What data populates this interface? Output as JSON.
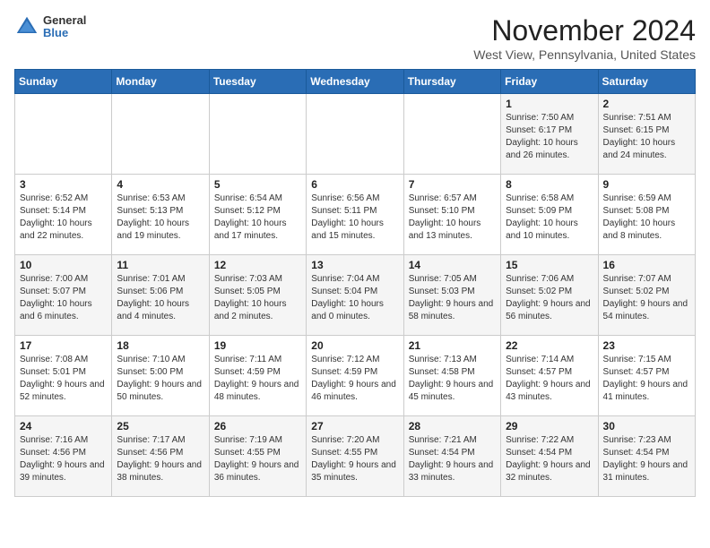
{
  "logo": {
    "general": "General",
    "blue": "Blue"
  },
  "title": "November 2024",
  "location": "West View, Pennsylvania, United States",
  "days_of_week": [
    "Sunday",
    "Monday",
    "Tuesday",
    "Wednesday",
    "Thursday",
    "Friday",
    "Saturday"
  ],
  "weeks": [
    [
      {
        "day": "",
        "info": ""
      },
      {
        "day": "",
        "info": ""
      },
      {
        "day": "",
        "info": ""
      },
      {
        "day": "",
        "info": ""
      },
      {
        "day": "",
        "info": ""
      },
      {
        "day": "1",
        "info": "Sunrise: 7:50 AM\nSunset: 6:17 PM\nDaylight: 10 hours and 26 minutes."
      },
      {
        "day": "2",
        "info": "Sunrise: 7:51 AM\nSunset: 6:15 PM\nDaylight: 10 hours and 24 minutes."
      }
    ],
    [
      {
        "day": "3",
        "info": "Sunrise: 6:52 AM\nSunset: 5:14 PM\nDaylight: 10 hours and 22 minutes."
      },
      {
        "day": "4",
        "info": "Sunrise: 6:53 AM\nSunset: 5:13 PM\nDaylight: 10 hours and 19 minutes."
      },
      {
        "day": "5",
        "info": "Sunrise: 6:54 AM\nSunset: 5:12 PM\nDaylight: 10 hours and 17 minutes."
      },
      {
        "day": "6",
        "info": "Sunrise: 6:56 AM\nSunset: 5:11 PM\nDaylight: 10 hours and 15 minutes."
      },
      {
        "day": "7",
        "info": "Sunrise: 6:57 AM\nSunset: 5:10 PM\nDaylight: 10 hours and 13 minutes."
      },
      {
        "day": "8",
        "info": "Sunrise: 6:58 AM\nSunset: 5:09 PM\nDaylight: 10 hours and 10 minutes."
      },
      {
        "day": "9",
        "info": "Sunrise: 6:59 AM\nSunset: 5:08 PM\nDaylight: 10 hours and 8 minutes."
      }
    ],
    [
      {
        "day": "10",
        "info": "Sunrise: 7:00 AM\nSunset: 5:07 PM\nDaylight: 10 hours and 6 minutes."
      },
      {
        "day": "11",
        "info": "Sunrise: 7:01 AM\nSunset: 5:06 PM\nDaylight: 10 hours and 4 minutes."
      },
      {
        "day": "12",
        "info": "Sunrise: 7:03 AM\nSunset: 5:05 PM\nDaylight: 10 hours and 2 minutes."
      },
      {
        "day": "13",
        "info": "Sunrise: 7:04 AM\nSunset: 5:04 PM\nDaylight: 10 hours and 0 minutes."
      },
      {
        "day": "14",
        "info": "Sunrise: 7:05 AM\nSunset: 5:03 PM\nDaylight: 9 hours and 58 minutes."
      },
      {
        "day": "15",
        "info": "Sunrise: 7:06 AM\nSunset: 5:02 PM\nDaylight: 9 hours and 56 minutes."
      },
      {
        "day": "16",
        "info": "Sunrise: 7:07 AM\nSunset: 5:02 PM\nDaylight: 9 hours and 54 minutes."
      }
    ],
    [
      {
        "day": "17",
        "info": "Sunrise: 7:08 AM\nSunset: 5:01 PM\nDaylight: 9 hours and 52 minutes."
      },
      {
        "day": "18",
        "info": "Sunrise: 7:10 AM\nSunset: 5:00 PM\nDaylight: 9 hours and 50 minutes."
      },
      {
        "day": "19",
        "info": "Sunrise: 7:11 AM\nSunset: 4:59 PM\nDaylight: 9 hours and 48 minutes."
      },
      {
        "day": "20",
        "info": "Sunrise: 7:12 AM\nSunset: 4:59 PM\nDaylight: 9 hours and 46 minutes."
      },
      {
        "day": "21",
        "info": "Sunrise: 7:13 AM\nSunset: 4:58 PM\nDaylight: 9 hours and 45 minutes."
      },
      {
        "day": "22",
        "info": "Sunrise: 7:14 AM\nSunset: 4:57 PM\nDaylight: 9 hours and 43 minutes."
      },
      {
        "day": "23",
        "info": "Sunrise: 7:15 AM\nSunset: 4:57 PM\nDaylight: 9 hours and 41 minutes."
      }
    ],
    [
      {
        "day": "24",
        "info": "Sunrise: 7:16 AM\nSunset: 4:56 PM\nDaylight: 9 hours and 39 minutes."
      },
      {
        "day": "25",
        "info": "Sunrise: 7:17 AM\nSunset: 4:56 PM\nDaylight: 9 hours and 38 minutes."
      },
      {
        "day": "26",
        "info": "Sunrise: 7:19 AM\nSunset: 4:55 PM\nDaylight: 9 hours and 36 minutes."
      },
      {
        "day": "27",
        "info": "Sunrise: 7:20 AM\nSunset: 4:55 PM\nDaylight: 9 hours and 35 minutes."
      },
      {
        "day": "28",
        "info": "Sunrise: 7:21 AM\nSunset: 4:54 PM\nDaylight: 9 hours and 33 minutes."
      },
      {
        "day": "29",
        "info": "Sunrise: 7:22 AM\nSunset: 4:54 PM\nDaylight: 9 hours and 32 minutes."
      },
      {
        "day": "30",
        "info": "Sunrise: 7:23 AM\nSunset: 4:54 PM\nDaylight: 9 hours and 31 minutes."
      }
    ]
  ]
}
